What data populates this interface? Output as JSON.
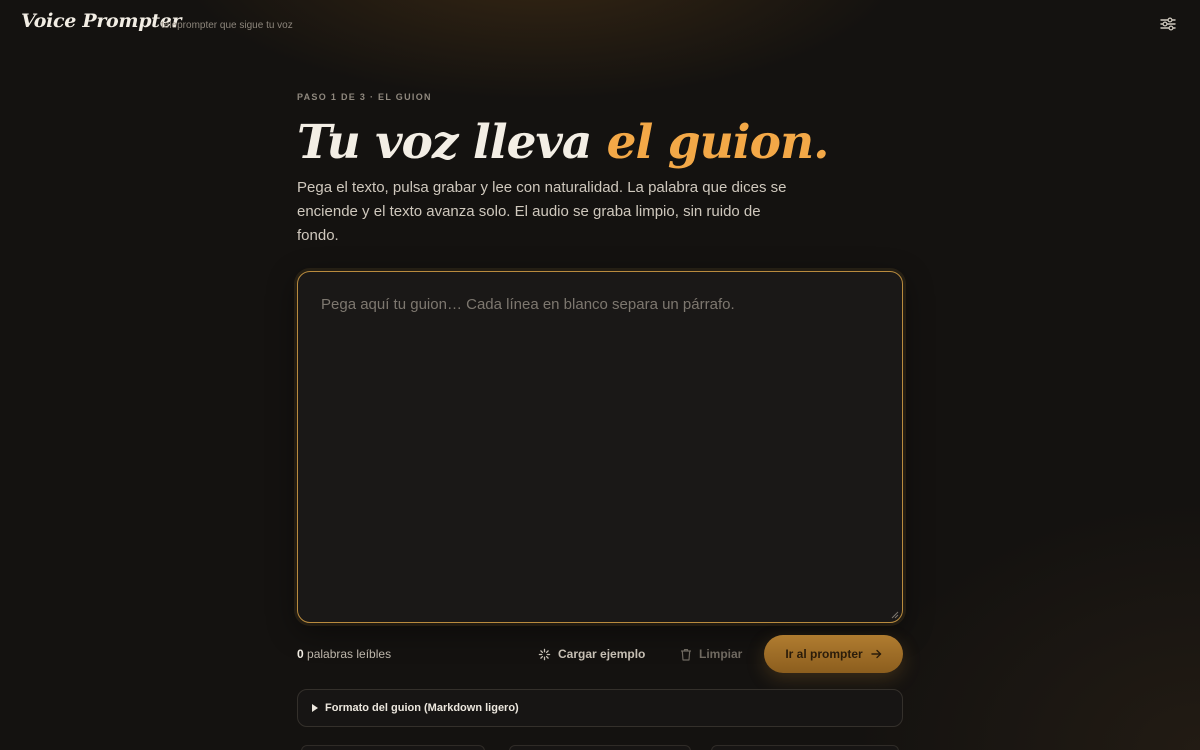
{
  "header": {
    "brand": "Voice Prompter",
    "tagline": "teleprompter que sigue tu voz",
    "settings_icon": "sliders-icon"
  },
  "hero": {
    "step": "PASO 1 DE 3 · EL GUION",
    "title_main": "Tu voz lleva ",
    "title_accent": "el guion.",
    "description": "Pega el texto, pulsa grabar y lee con naturalidad. La palabra que dices se enciende y el texto avanza solo. El audio se graba limpio, sin ruido de fondo."
  },
  "editor": {
    "value": "",
    "placeholder": "Pega aquí tu guion… Cada línea en blanco separa un párrafo."
  },
  "actions": {
    "word_count": "0",
    "word_count_label": " palabras leíbles",
    "load_example": "Cargar ejemplo",
    "clear": "Limpiar",
    "go": "Ir al prompter"
  },
  "format_help": {
    "label": "Formato del guion (Markdown ligero)"
  },
  "colors": {
    "accent": "#f3a847",
    "primary_button": "#a8742a",
    "background": "#141210"
  }
}
